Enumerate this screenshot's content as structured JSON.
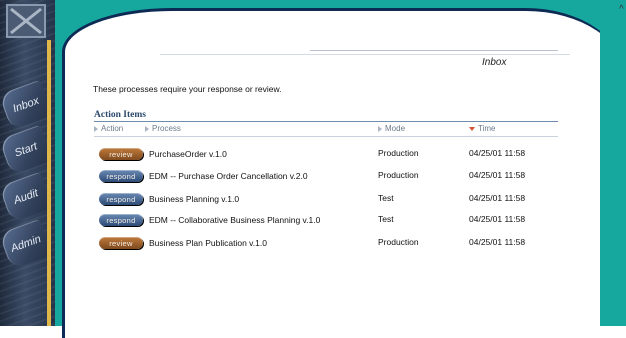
{
  "sidebar": {
    "tabs": [
      {
        "label": "Inbox",
        "id": "inbox"
      },
      {
        "label": "Start",
        "id": "start"
      },
      {
        "label": "Audit",
        "id": "audit"
      },
      {
        "label": "Admin",
        "id": "admin"
      }
    ]
  },
  "header": {
    "title": "Inbox"
  },
  "intro": "These processes require your response or review.",
  "section_title": "Action Items",
  "columns": {
    "action": "Action",
    "process": "Process",
    "mode": "Mode",
    "time": "Time"
  },
  "rows": [
    {
      "action": "review",
      "process": "PurchaseOrder v.1.0",
      "mode": "Production",
      "time": "04/25/01 11:58"
    },
    {
      "action": "respond",
      "process": "EDM -- Purchase Order Cancellation v.2.0",
      "mode": "Production",
      "time": "04/25/01 11:58"
    },
    {
      "action": "respond",
      "process": "Business Planning v.1.0",
      "mode": "Test",
      "time": "04/25/01 11:58"
    },
    {
      "action": "respond",
      "process": "EDM -- Collaborative Business Planning v.1.0",
      "mode": "Test",
      "time": "04/25/01 11:58"
    },
    {
      "action": "review",
      "process": "Business Plan Publication v.1.0",
      "mode": "Production",
      "time": "04/25/01 11:58"
    }
  ],
  "colors": {
    "frame": "#16a89e",
    "sidebar": "#2b3a52",
    "accent": "#e0b84a",
    "review_btn": "#9a5a28",
    "respond_btn": "#3d5d8c"
  }
}
